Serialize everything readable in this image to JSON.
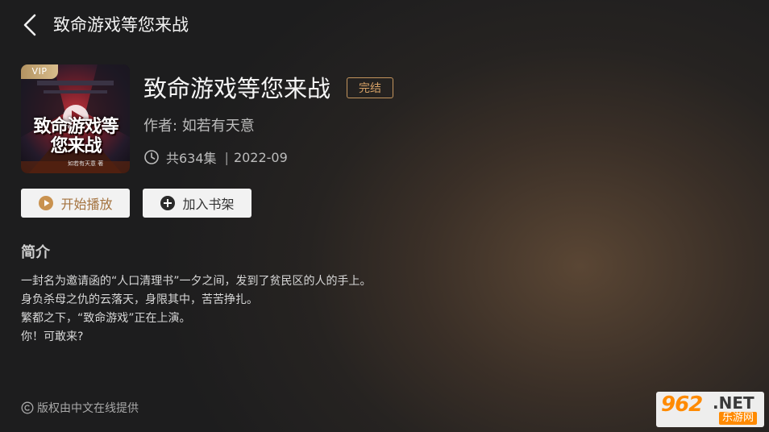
{
  "header": {
    "title": "致命游戏等您来战"
  },
  "book": {
    "vip_label": "VIP",
    "cover_title": "致命游戏等您来战",
    "cover_subtitle": "如若有天意 著",
    "title": "致命游戏等您来战",
    "status": "完结",
    "author": "作者: 如若有天意",
    "episodes": "共634集",
    "date_separator": "|",
    "date": "2022-09"
  },
  "actions": {
    "play_label": "开始播放",
    "shelf_label": "加入书架"
  },
  "intro": {
    "heading": "简介",
    "lines": [
      "一封名为邀请函的“人口清理书”一夕之间，发到了贫民区的人的手上。",
      "身负杀母之仇的云落天，身限其中，苦苦挣扎。",
      "繁都之下，“致命游戏”正在上演。",
      "你！可敢来?"
    ]
  },
  "footer": {
    "copyright": "版权由中文在线提供"
  },
  "watermark": {
    "number": "962",
    "net": ".NET",
    "site": "乐游网"
  },
  "colors": {
    "accent": "#c4955d",
    "button_bg": "#f2f2f2",
    "watermark_orange": "#ff8a00"
  },
  "icons": [
    "back-arrow-icon",
    "clock-icon",
    "play-icon",
    "plus-circle-icon",
    "copyright-icon"
  ]
}
